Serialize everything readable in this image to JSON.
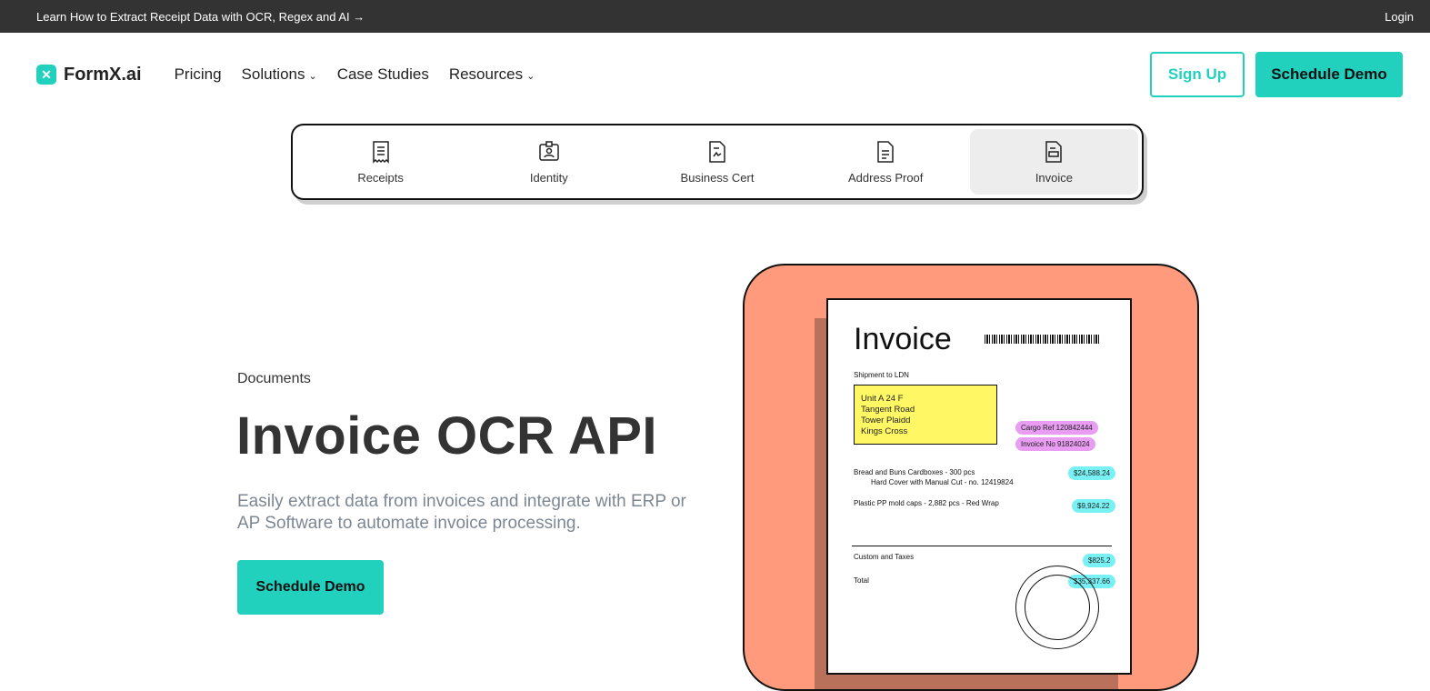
{
  "topbar": {
    "announcement": "Learn How to Extract Receipt Data with OCR, Regex and AI →",
    "login": "Login"
  },
  "nav": {
    "logo_text": "FormX.ai",
    "links": [
      {
        "label": "Pricing"
      },
      {
        "label": "Solutions"
      },
      {
        "label": "Case Studies"
      },
      {
        "label": "Resources"
      }
    ],
    "signup": "Sign Up",
    "schedule_demo": "Schedule Demo"
  },
  "tabs": [
    {
      "label": "Receipts",
      "icon": "receipt-icon"
    },
    {
      "label": "Identity",
      "icon": "id-card-icon"
    },
    {
      "label": "Business Cert",
      "icon": "certificate-icon"
    },
    {
      "label": "Address Proof",
      "icon": "document-icon"
    },
    {
      "label": "Invoice",
      "icon": "invoice-icon",
      "active": true
    }
  ],
  "hero": {
    "eyebrow": "Documents",
    "title": "Invoice OCR API",
    "subtitle": "Easily extract data from invoices and integrate with ERP or AP Software to automate invoice processing.",
    "cta": "Schedule Demo"
  },
  "invoice": {
    "title": "Invoice",
    "shipment": "Shipment to LDN",
    "address": [
      "Unit A 24 F",
      "Tangent Road",
      "Tower Plaidd",
      "Kings Cross"
    ],
    "cargo_ref": "Cargo Ref 120842444",
    "invoice_no": "Invoice No 91824024",
    "line1": "Bread and Buns Cardboxes - 300 pcs",
    "line1b": "Hard Cover with Manual Cut - no. 12419824",
    "amount1": "$24,588.24",
    "line2": "Plastic PP mold caps - 2,882 pcs - Red Wrap",
    "amount2": "$9,924.22",
    "custom_label": "Custom and Taxes",
    "custom_amount": "$825.2",
    "total_label": "Total",
    "total_amount": "$35,337.66"
  },
  "colors": {
    "accent": "#21d1be",
    "topbar": "#333333",
    "art_bg": "#ff9b7c",
    "highlight_yellow": "#fff864",
    "pill_pink": "#e89cf2",
    "pill_cyan": "#78f1f5"
  }
}
